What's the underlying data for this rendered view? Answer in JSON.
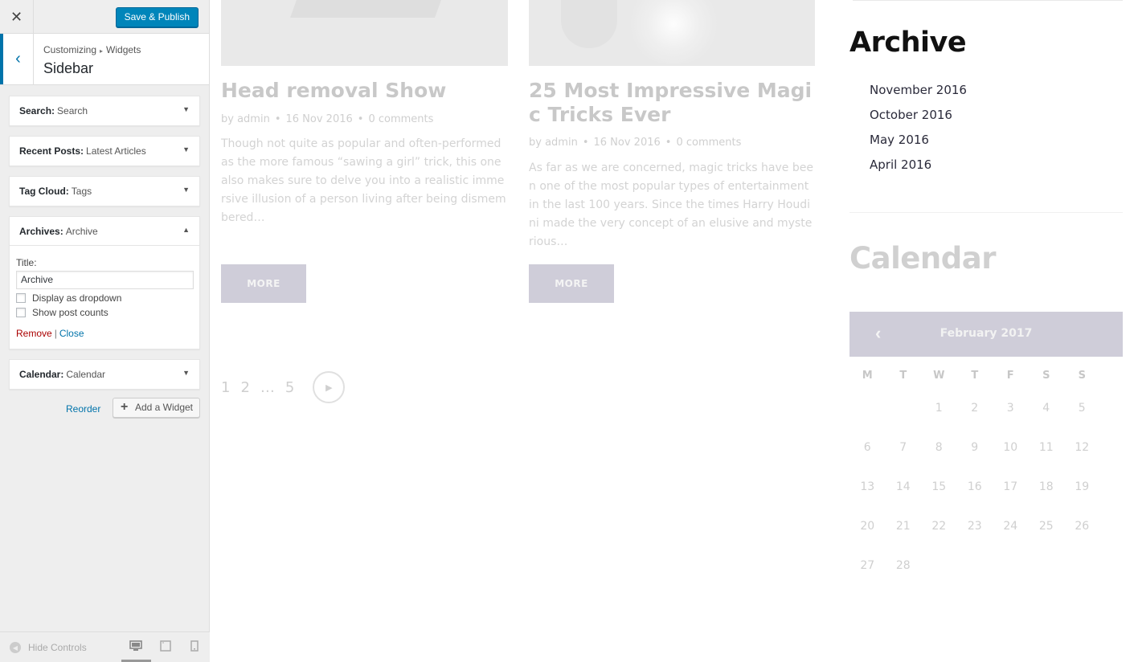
{
  "customizer": {
    "close_icon": "close-icon",
    "publish_label": "Save & Publish",
    "breadcrumb": [
      "Customizing",
      "Widgets"
    ],
    "section_title": "Sidebar",
    "widgets": [
      {
        "type": "Search:",
        "name": "Search"
      },
      {
        "type": "Recent Posts:",
        "name": "Latest Articles"
      },
      {
        "type": "Tag Cloud:",
        "name": "Tags"
      },
      {
        "type": "Archives:",
        "name": "Archive"
      },
      {
        "type": "Calendar:",
        "name": "Calendar"
      }
    ],
    "archives_form": {
      "title_label": "Title:",
      "title_value": "Archive",
      "dropdown_label": "Display as dropdown",
      "counts_label": "Show post counts",
      "remove_label": "Remove",
      "separator": "|",
      "close_label": "Close"
    },
    "reorder_label": "Reorder",
    "add_widget_label": "Add a Widget",
    "hide_controls_label": "Hide Controls",
    "accent_color": "#0073aa",
    "publish_color": "#0085ba"
  },
  "preview": {
    "posts": [
      {
        "title": "Head removal Show",
        "author_prefix": "by",
        "author": "admin",
        "date": "16 Nov 2016",
        "comments": "0 comments",
        "excerpt": "Though not quite as popular and often-performed as the more famous “sawing a girl” trick, this one also makes sure to delve you into a realistic immersive illusion of a person living after being dismembered…",
        "more": "MORE"
      },
      {
        "title": "25 Most Impressive Magic Tricks Ever",
        "author_prefix": "by",
        "author": "admin",
        "date": "16 Nov 2016",
        "comments": "0 comments",
        "excerpt": "As far as we are concerned, magic tricks have been one of the most popular types of entertainment in the last 100 years. Since the times Harry Houdini made the very concept of an elusive and mysterious…",
        "more": "MORE"
      }
    ],
    "pagination": [
      "1",
      "2",
      "…",
      "5"
    ],
    "archive_title": "Archive",
    "archive_items": [
      "November 2016",
      "October 2016",
      "May 2016",
      "April 2016"
    ],
    "calendar_title": "Calendar",
    "calendar_month": "February 2017",
    "calendar_days": [
      "M",
      "T",
      "W",
      "T",
      "F",
      "S",
      "S"
    ],
    "calendar_weeks": [
      [
        "",
        "",
        "1",
        "2",
        "3",
        "4",
        "5"
      ],
      [
        "6",
        "7",
        "8",
        "9",
        "10",
        "11",
        "12"
      ],
      [
        "13",
        "14",
        "15",
        "16",
        "17",
        "18",
        "19"
      ],
      [
        "20",
        "21",
        "22",
        "23",
        "24",
        "25",
        "26"
      ],
      [
        "27",
        "28",
        "",
        "",
        "",
        "",
        ""
      ]
    ],
    "calendar_header_color": "#cfcdd9"
  }
}
